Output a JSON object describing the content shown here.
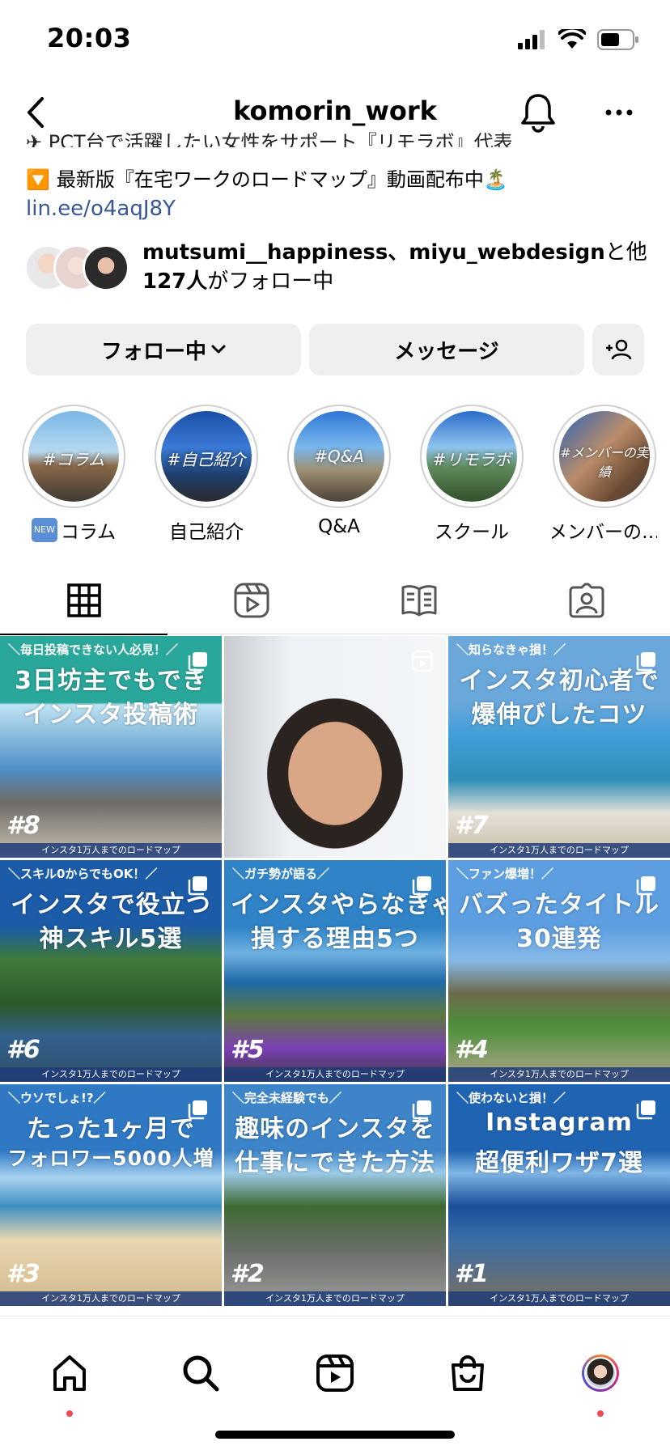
{
  "status": {
    "time": "20:03"
  },
  "header": {
    "username": "komorin_work"
  },
  "bio": {
    "line1": "✈ PCT台で活躍したい女性をサポート『リモラボ』代表",
    "line2_badge": "🔽",
    "line2": "最新版『在宅ワークのロードマップ』動画配布中🏝️",
    "link": "lin.ee/o4aqJ8Y"
  },
  "followed_by": {
    "names": "mutsumi__happiness、miyu_webdesign",
    "suffix1": "と他",
    "count": "127人",
    "suffix2": "がフォロー中"
  },
  "buttons": {
    "following": "フォロー中",
    "message": "メッセージ"
  },
  "highlights": [
    {
      "label": "コラム",
      "badge": "NEW",
      "cover_text": "#コラム"
    },
    {
      "label": "自己紹介",
      "cover_text": "#自己紹介"
    },
    {
      "label": "Q&A",
      "cover_text": "#Q&A"
    },
    {
      "label": "スクール",
      "cover_text": "#リモラボ"
    },
    {
      "label": "メンバーの…",
      "cover_text": "#メンバーの実績"
    }
  ],
  "posts": [
    {
      "sub": "＼毎日投稿できない人必見！／",
      "t1": "3日坊主でもでき",
      "t2": "インスタ投稿術",
      "num": "#8",
      "foot": "インスタ1万人までのロードマップ"
    },
    {
      "sub": "",
      "t1": "",
      "t2": "",
      "num": "",
      "foot": ""
    },
    {
      "sub": "＼知らなきゃ損！／",
      "t1": "インスタ初心者で",
      "t2": "爆伸びしたコツ",
      "num": "#7",
      "foot": "インスタ1万人までのロードマップ"
    },
    {
      "sub": "＼スキル0からでもOK！／",
      "t1": "インスタで役立つ",
      "t2": "神スキル5選",
      "num": "#6",
      "foot": "インスタ1万人までのロードマップ"
    },
    {
      "sub": "＼ガチ勢が語る／",
      "t1": "インスタやらなきゃ",
      "t2": "損する理由5つ",
      "num": "#5",
      "foot": "インスタ1万人までのロードマップ"
    },
    {
      "sub": "＼ファン爆増！／",
      "t1": "バズったタイトル",
      "t2": "30連発",
      "num": "#4",
      "foot": "インスタ1万人までのロードマップ"
    },
    {
      "sub": "＼ウソでしょ!?／",
      "t1": "たった1ヶ月で",
      "t2": "フォロワー5000人増",
      "num": "#3",
      "foot": "インスタ1万人までのロードマップ"
    },
    {
      "sub": "＼完全未経験でも／",
      "t1": "趣味のインスタを",
      "t2": "仕事にできた方法",
      "num": "#2",
      "foot": "インスタ1万人までのロードマップ"
    },
    {
      "sub": "＼使わないと損！／",
      "t1": "Instagram",
      "t2": "超便利ワザ7選",
      "num": "#1",
      "foot": "インスタ1万人までのロードマップ"
    }
  ],
  "colors": {
    "link": "#385898",
    "notification_dot": "#ed4956",
    "button_bg": "#efefef"
  }
}
